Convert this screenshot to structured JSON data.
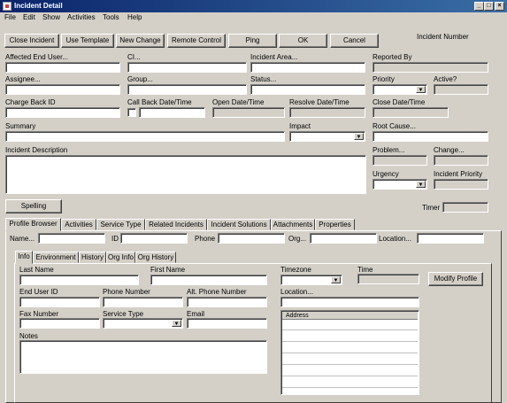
{
  "window": {
    "title": "Incident Detail",
    "minimize": "_",
    "maximize": "□",
    "close": "×"
  },
  "menu": [
    "File",
    "Edit",
    "Show",
    "Activities",
    "Tools",
    "Help"
  ],
  "toolbar": {
    "close_incident": "Close Incident",
    "use_template": "Use Template",
    "new_change": "New Change",
    "remote_control": "Remote Control",
    "ping": "Ping",
    "ok": "OK",
    "cancel": "Cancel",
    "incident_number_label": "Incident Number"
  },
  "labels": {
    "affected_end_user": "Affected End User...",
    "ci": "CI...",
    "incident_area": "Incident Area...",
    "reported_by": "Reported By",
    "assignee": "Assignee...",
    "group": "Group...",
    "status": "Status...",
    "priority": "Priority",
    "active": "Active?",
    "charge_back_id": "Charge Back ID",
    "call_back": "Call Back Date/Time",
    "open_date": "Open Date/Time",
    "resolve_date": "Resolve Date/Time",
    "close_date": "Close Date/Time",
    "summary": "Summary",
    "impact": "Impact",
    "root_cause": "Root Cause...",
    "incident_description": "Incident Description",
    "problem": "Problem...",
    "change": "Change...",
    "urgency": "Urgency",
    "incident_priority": "Incident Priority",
    "spelling": "Spelling",
    "timer": "Timer"
  },
  "tabs": [
    "Profile Browser",
    "Activities",
    "Service Type",
    "Related Incidents",
    "Incident Solutions",
    "Attachments",
    "Properties"
  ],
  "profile_search": {
    "name": "Name...",
    "id": "ID",
    "phone": "Phone",
    "org": "Org...",
    "location": "Location..."
  },
  "subtabs": [
    "Info",
    "Environment",
    "History",
    "Org Info",
    "Org History"
  ],
  "info": {
    "last_name": "Last Name",
    "first_name": "First Name",
    "timezone": "Timezone",
    "time": "Time",
    "modify_profile": "Modify Profile",
    "end_user_id": "End User ID",
    "phone_number": "Phone Number",
    "alt_phone_number": "Alt. Phone Number",
    "location": "Location...",
    "fax_number": "Fax Number",
    "service_type": "Service Type",
    "email": "Email",
    "address": "Address",
    "notes": "Notes"
  }
}
